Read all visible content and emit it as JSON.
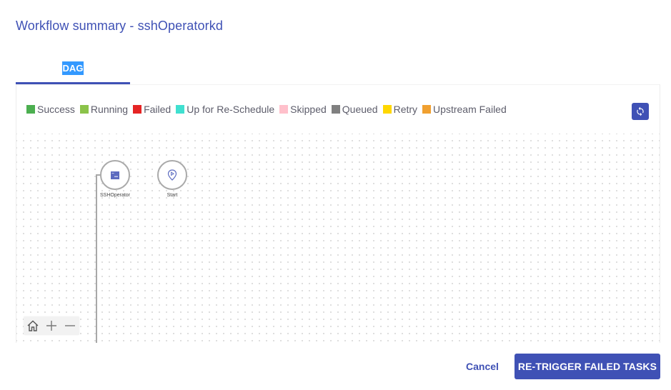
{
  "dialog": {
    "title": "Workflow summary - sshOperatorkd"
  },
  "tabs": [
    {
      "label": "DAG",
      "active": true
    }
  ],
  "legend": [
    {
      "label": "Success",
      "color": "#4caf50"
    },
    {
      "label": "Running",
      "color": "#8bc34a"
    },
    {
      "label": "Failed",
      "color": "#e52424"
    },
    {
      "label": "Up for Re-Schedule",
      "color": "#40e0d0"
    },
    {
      "label": "Skipped",
      "color": "#ffc0cb"
    },
    {
      "label": "Queued",
      "color": "#808080"
    },
    {
      "label": "Retry",
      "color": "#ffd700"
    },
    {
      "label": "Upstream Failed",
      "color": "#f0a030"
    }
  ],
  "toolbar": {
    "refresh_icon": "refresh-icon"
  },
  "graph": {
    "nodes": [
      {
        "id": "ssh",
        "label": "SSHOperator",
        "icon": "terminal-icon"
      },
      {
        "id": "start",
        "label": "Start",
        "icon": "location-play-icon"
      }
    ]
  },
  "zoom_controls": {
    "home_icon": "home-icon",
    "zoom_in_icon": "plus-icon",
    "zoom_out_icon": "minus-icon"
  },
  "actions": {
    "cancel_label": "Cancel",
    "retrigger_label": "RE-TRIGGER FAILED TASKS"
  },
  "colors": {
    "accent": "#3f51b5",
    "tab_highlight": "#3399ff"
  }
}
